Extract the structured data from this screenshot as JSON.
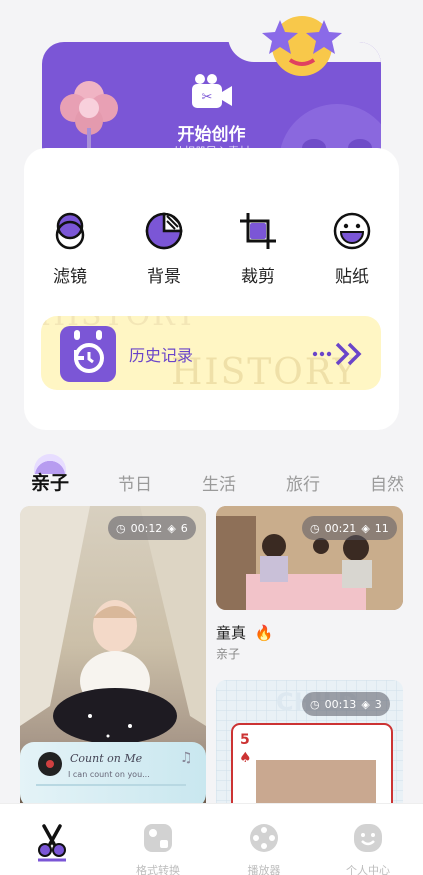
{
  "create": {
    "title": "开始创作",
    "subtitle": "从相册导入素材"
  },
  "tools": [
    {
      "label": "滤镜",
      "icon": "filter-icon"
    },
    {
      "label": "背景",
      "icon": "background-icon"
    },
    {
      "label": "裁剪",
      "icon": "crop-icon"
    },
    {
      "label": "贴纸",
      "icon": "sticker-icon"
    }
  ],
  "history": {
    "label": "历史记录",
    "watermark": "HISTORY"
  },
  "tabs": [
    "亲子",
    "节日",
    "生活",
    "旅行",
    "自然"
  ],
  "feed": {
    "baby": {
      "duration": "00:12",
      "layers": "6"
    },
    "kids": {
      "duration": "00:21",
      "layers": "11",
      "title": "童真",
      "tag": "亲子"
    },
    "child": {
      "duration": "00:13",
      "layers": "3",
      "card_number": "5"
    },
    "music": {
      "title": "Count on Me",
      "line": "I can count on you..."
    }
  },
  "nav": [
    "",
    "格式转换",
    "播放器",
    "个人中心"
  ],
  "colors": {
    "accent": "#7b56d6",
    "banner": "#fff6c4"
  }
}
